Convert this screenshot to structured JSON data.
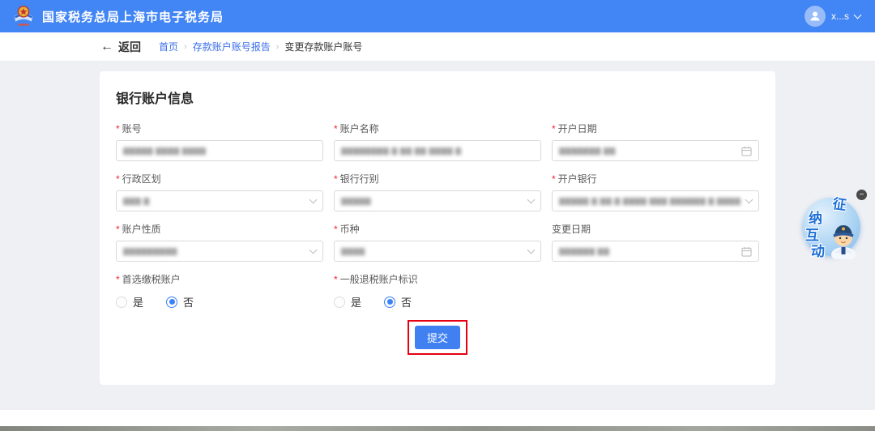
{
  "header": {
    "title": "国家税务总局上海市电子税务局",
    "user_name": "x...s"
  },
  "breadcrumb": {
    "back": "返回",
    "back_arrow": "←",
    "home": "首页",
    "parent": "存款账户账号报告",
    "current": "变更存款账户账号",
    "sep": "›"
  },
  "form": {
    "section_title": "银行账户信息",
    "fields": [
      {
        "label": "账号",
        "required": "*",
        "value": "▇▇▇▇▇ ▇▇▇▇ ▇▇▇▇"
      },
      {
        "label": "账户名称",
        "required": "*",
        "value": "▇▇▇▇▇▇▇▇ ▇ ▇▇ ▇▇ ▇▇▇▇ ▇"
      },
      {
        "label": "开户日期",
        "required": "*",
        "value": "▇▇▇▇▇▇▇ ▇▇"
      },
      {
        "label": "行政区划",
        "required": "*",
        "value": "▇▇▇ ▇"
      },
      {
        "label": "银行行别",
        "required": "*",
        "value": "▇▇▇▇▇"
      },
      {
        "label": "开户银行",
        "required": "*",
        "value": "▇▇▇▇▇ ▇ ▇▇ ▇ ▇▇▇▇ ▇▇▇  ▇▇▇▇▇▇ ▇  ▇▇▇▇"
      },
      {
        "label": "账户性质",
        "required": "*",
        "value": "▇▇▇▇▇▇▇▇▇"
      },
      {
        "label": "币种",
        "required": "*",
        "value": "▇▇▇▇"
      },
      {
        "label": "变更日期",
        "required": "",
        "value": "▇▇▇▇▇▇ ▇▇"
      }
    ],
    "radios": [
      {
        "label": "首选缴税账户",
        "required": "*",
        "yes": "是",
        "no": "否",
        "selected": "否"
      },
      {
        "label": "一般退税账户标识",
        "required": "*",
        "yes": "是",
        "no": "否",
        "selected": "否"
      }
    ],
    "submit_label": "提交"
  },
  "assistant_widget": {
    "char1": "征",
    "char2": "纳",
    "char3": "互",
    "char4": "动",
    "minimize": "−"
  },
  "colors": {
    "header_blue": "#4285f4",
    "link_blue": "#3a6ee8",
    "primary_button": "#4080f0",
    "annotation_red": "#e60012",
    "required_red": "#f5222d"
  }
}
